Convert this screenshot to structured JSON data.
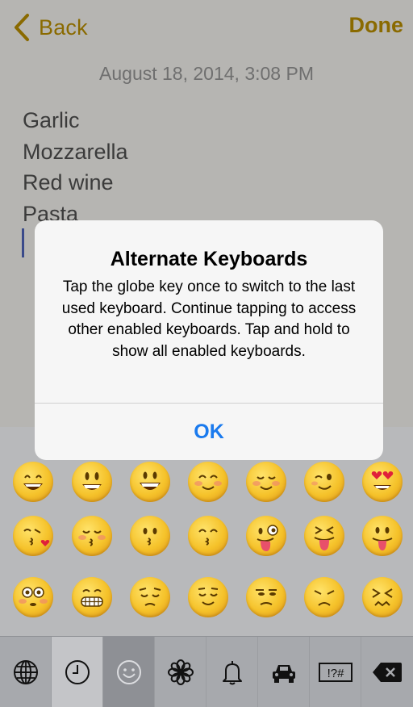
{
  "nav": {
    "back_label": "Back",
    "done_label": "Done"
  },
  "note": {
    "date": "August 18, 2014, 3:08 PM",
    "lines": [
      "Garlic",
      "Mozzarella",
      "Red wine",
      "Pasta"
    ]
  },
  "alert": {
    "title": "Alternate Keyboards",
    "message": "Tap the globe key once to switch to the last used keyboard. Continue tapping to access other enabled keyboards. Tap and hold to show all enabled keyboards.",
    "ok_label": "OK"
  },
  "emoji": {
    "icons": [
      "grinning-smiling-eyes-icon",
      "grinning-icon",
      "grin-icon",
      "smiling-blush-icon",
      "relaxed-icon",
      "winking-icon",
      "heart-eyes-icon",
      "kissing-heart-icon",
      "kissing-closed-eyes-icon",
      "kissing-icon",
      "kissing-smiling-eyes-icon",
      "winking-tongue-icon",
      "squinting-tongue-icon",
      "tongue-out-icon",
      "flushed-icon",
      "grimacing-icon",
      "pensive-icon",
      "relieved-icon",
      "unamused-icon",
      "disappointed-icon",
      "confounded-icon"
    ]
  },
  "toolbar": {
    "icons": [
      "globe-icon",
      "recent-clock-icon",
      "smiley-category-icon",
      "flower-category-icon",
      "bell-category-icon",
      "car-category-icon",
      "symbols-category-icon",
      "delete-icon"
    ],
    "symbols_label": "!?#"
  },
  "colors": {
    "accent": "#8a6a00",
    "alert_button": "#1a7aee"
  }
}
